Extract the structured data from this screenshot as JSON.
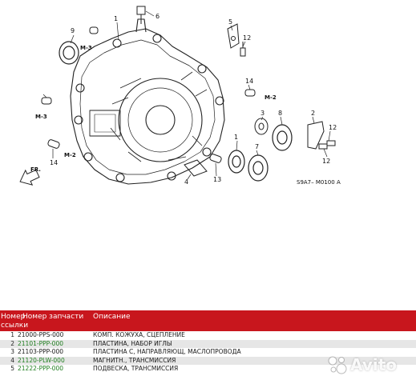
{
  "diagram": {
    "code": "S9A7– M0100 A",
    "fr_label": "FR.",
    "callouts": [
      "1",
      "2",
      "3",
      "4",
      "5",
      "6",
      "7",
      "8",
      "9",
      "12",
      "12",
      "13",
      "14",
      "14",
      "14"
    ],
    "wrench_labels": [
      "M-3",
      "M-3",
      "M-2",
      "M-2"
    ]
  },
  "table": {
    "headers": {
      "ref_line1": "Номер",
      "ref_line2": "ссылки",
      "part_number": "Номер запчасти",
      "description": "Описание"
    },
    "rows": [
      {
        "index": "1",
        "part": "21000-PPS-000",
        "desc": "КОМП. КОЖУХА, СЦЕПЛЕНИЕ",
        "link": false
      },
      {
        "index": "2",
        "part": "21101-PPP-000",
        "desc": "ПЛАСТИНА, НАБОР ИГЛЫ",
        "link": true
      },
      {
        "index": "3",
        "part": "21103-PPP-000",
        "desc": "ПЛАСТИНА С, НАПРАВЛЯЮЩ, МАСЛОПРОВОДА",
        "link": false
      },
      {
        "index": "4",
        "part": "21120-PLW-000",
        "desc": "МАГНИТН., ТРАНСМИССИЯ",
        "link": true
      },
      {
        "index": "5",
        "part": "21222-PPP-000",
        "desc": "ПОДВЕСКА, ТРАНСМИССИЯ",
        "link": true
      }
    ]
  },
  "watermark": {
    "text": "Avito"
  },
  "colors": {
    "header_bg": "#c8161d",
    "link_green": "#1e7d1e",
    "row_alt": "#e6e6e6"
  }
}
